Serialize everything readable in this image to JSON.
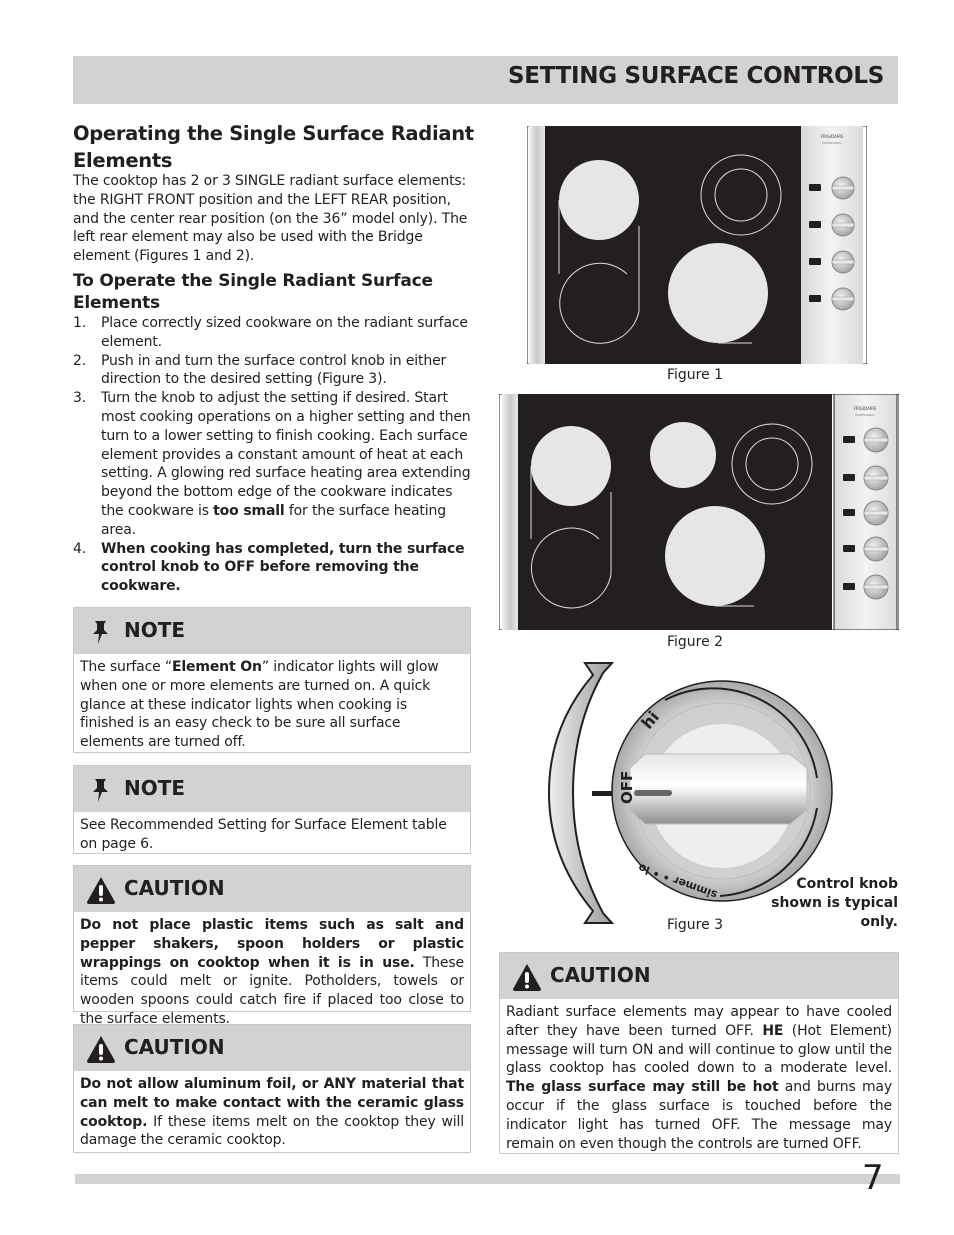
{
  "header": {
    "title": "SETTING SURFACE CONTROLS"
  },
  "section": {
    "title": "Operating the Single Surface Radiant Elements",
    "intro": "The cooktop has 2 or 3 SINGLE radiant surface elements: the RIGHT FRONT position and the LEFT REAR position, and the center rear position (on the 36” model only). The left rear element may also be used with the Bridge element (Figures 1 and 2).",
    "subtitle": "To Operate the Single Radiant Surface Elements",
    "steps": [
      {
        "num": "1.",
        "text": "Place correctly sized cookware on the radiant surface element."
      },
      {
        "num": "2.",
        "text": "Push in and turn the surface control knob in either direction to the desired setting (Figure 3)."
      },
      {
        "num": "3.",
        "text_before": "Turn the knob to adjust the setting if desired. Start most cooking operations on a higher setting and then turn to a lower setting to finish cooking. Each surface element provides a constant amount of heat at each setting. A glowing red surface heating area extending beyond the bottom edge of the cookware indicates the cookware is ",
        "text_bold": "too small",
        "text_after": " for the surface heating area."
      },
      {
        "num": "4.",
        "text_bold": "When cooking has completed, turn the surface control knob to OFF before removing the cookware."
      }
    ]
  },
  "notes": [
    {
      "title": "NOTE",
      "icon": "pushpin-icon",
      "before": "The surface “",
      "bold": "Element On",
      "after": "” indicator lights will glow when one or more elements are turned on. A quick glance at these indicator lights when cooking is finished is an easy check to be sure all surface elements are turned off."
    },
    {
      "title": "NOTE",
      "icon": "pushpin-icon",
      "text": "See Recommended Setting for Surface Element table on page 6."
    }
  ],
  "cautions": [
    {
      "title": "CAUTION",
      "icon": "warning-triangle-icon",
      "bold": "Do not place plastic items such as salt and pepper shakers, spoon holders or plastic wrappings on cooktop when it is in use.",
      "after": " These items could melt or ignite. Potholders, towels or wooden spoons could catch fire if placed too close to the surface elements."
    },
    {
      "title": "CAUTION",
      "icon": "warning-triangle-icon",
      "bold": "Do not allow aluminum foil, or ANY material that can melt to make contact with the ceramic glass cooktop.",
      "after": " If these items melt on the cooktop they will damage the ceramic cooktop."
    },
    {
      "title": "CAUTION",
      "icon": "warning-triangle-icon",
      "p1": "Radiant surface elements may appear to have cooled after they have been turned OFF. ",
      "b1": "HE",
      "p2": " (Hot Element) message will turn ON and will continue to glow until the glass cooktop has cooled down to a moderate level. ",
      "b2": "The glass surface may still be hot",
      "p3": " and burns may occur if the glass surface is touched before the indicator light has turned OFF. The message may remain on even though the controls are turned OFF."
    }
  ],
  "figures": {
    "fig1": {
      "caption": "Figure 1",
      "brand": "FRIGIDAIRE",
      "brand_sub": "PROFESSIONAL",
      "knob_count": 4
    },
    "fig2": {
      "caption": "Figure 2",
      "brand": "FRIGIDAIRE",
      "brand_sub": "PROFESSIONAL",
      "knob_count": 5
    },
    "fig3": {
      "caption": "Figure 3",
      "labels": {
        "hi": "hi",
        "off": "OFF",
        "simmer": "simmer • • lo"
      },
      "note": "Control knob shown is typical only."
    }
  },
  "footer": {
    "page_number": "7"
  }
}
